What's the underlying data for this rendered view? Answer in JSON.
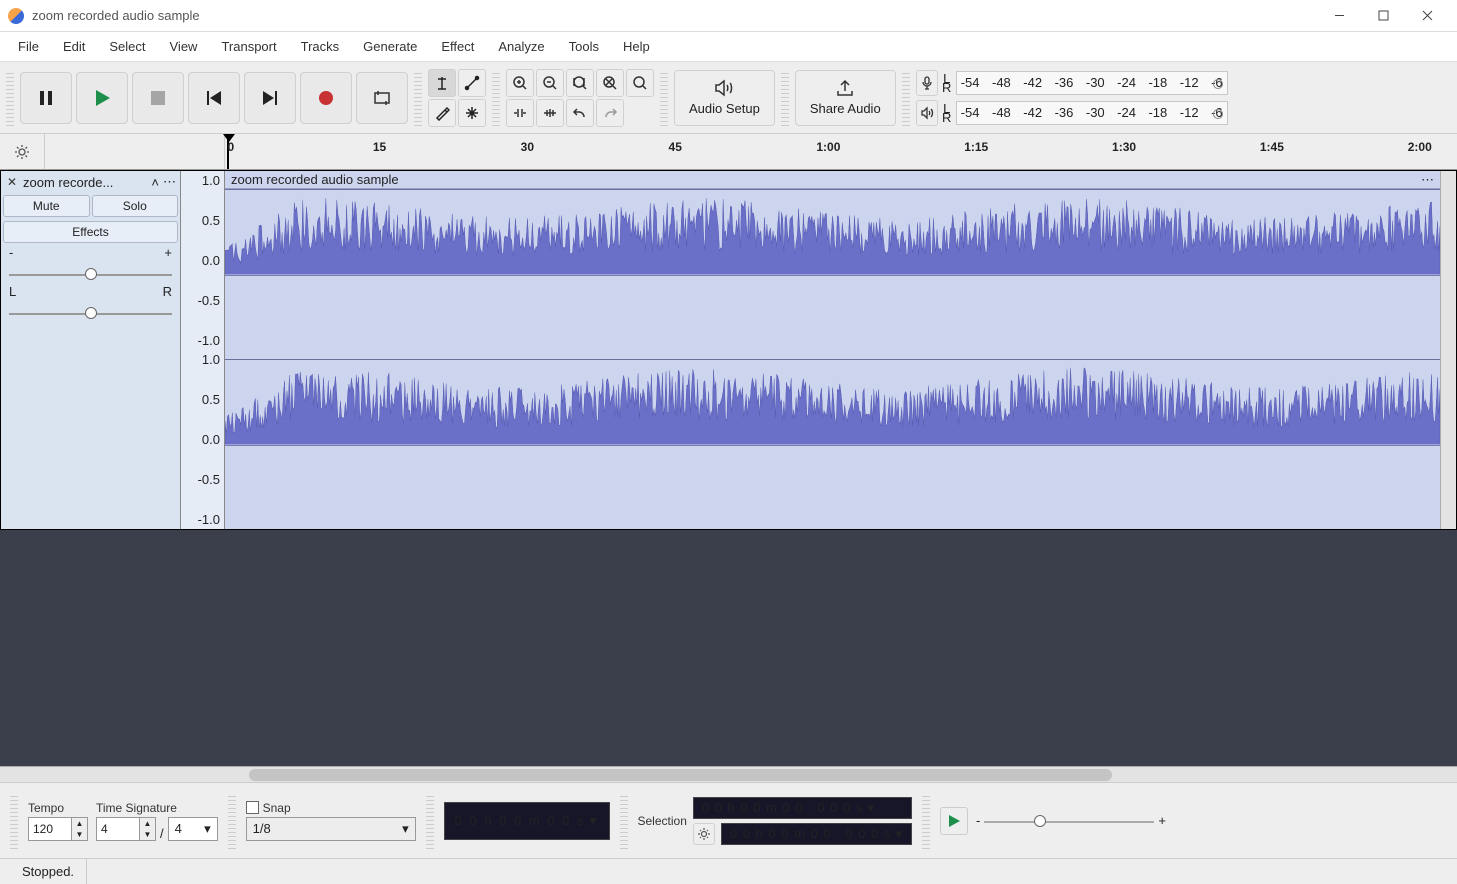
{
  "window": {
    "title": "zoom recorded audio sample"
  },
  "menu": [
    "File",
    "Edit",
    "Select",
    "View",
    "Transport",
    "Tracks",
    "Generate",
    "Effect",
    "Analyze",
    "Tools",
    "Help"
  ],
  "toolbar": {
    "audio_setup": "Audio Setup",
    "share_audio": "Share Audio"
  },
  "meters": {
    "lr": [
      "L",
      "R"
    ],
    "ticks": [
      "-54",
      "-48",
      "-42",
      "-36",
      "-30",
      "-24",
      "-18",
      "-12",
      "-6"
    ]
  },
  "ruler": {
    "labels": [
      "0",
      "15",
      "30",
      "45",
      "1:00",
      "1:15",
      "1:30",
      "1:45",
      "2:00"
    ]
  },
  "track": {
    "name_short": "zoom recorde...",
    "clip_name": "zoom recorded audio sample",
    "mute": "Mute",
    "solo": "Solo",
    "effects": "Effects",
    "gain_min": "-",
    "gain_max": "+",
    "pan_l": "L",
    "pan_r": "R",
    "vticks": [
      "1.0",
      "0.5",
      "0.0",
      "-0.5",
      "-1.0"
    ]
  },
  "bottom": {
    "tempo_label": "Tempo",
    "tempo_value": "120",
    "tsig_label": "Time Signature",
    "ts_num": "4",
    "ts_den": "4",
    "ts_sep": "/",
    "snap_label": "Snap",
    "snap_value": "1/8",
    "time_main": "0 0 h 0 0 m 0 0 s",
    "selection_label": "Selection",
    "sel_start": "0 0 h 0 0 m 0 0 . 0 0 0 s",
    "sel_end": "0 0 h 0 0 m 0 0 . 0 0 0 s",
    "speed_min": "-",
    "speed_max": "+"
  },
  "status": {
    "text": "Stopped."
  }
}
